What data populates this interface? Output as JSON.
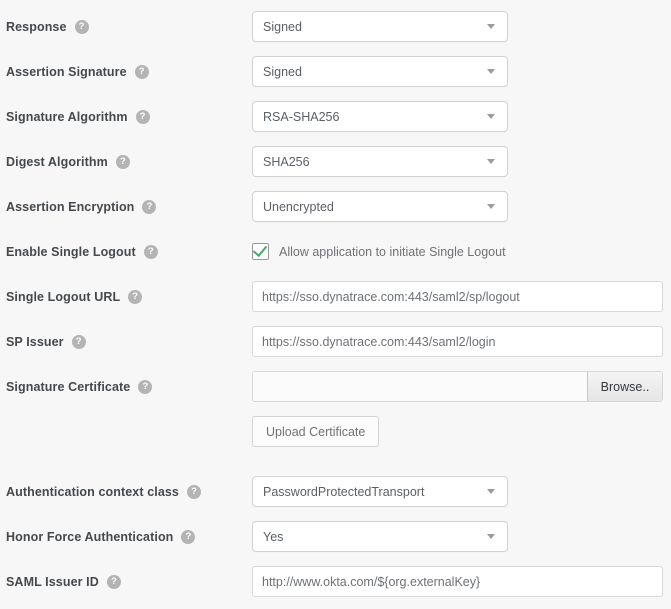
{
  "help_icon_glyph": "?",
  "colors": {
    "page_background": "#f7f7f7",
    "label_text": "#45494d",
    "value_text": "#5b6066",
    "help_bubble": "#b4b4b4",
    "checkbox_check": "#4aa96c",
    "field_border": "#d2d2d2"
  },
  "rows": [
    {
      "label": "Response",
      "type": "select",
      "value": "Signed"
    },
    {
      "label": "Assertion Signature",
      "type": "select",
      "value": "Signed"
    },
    {
      "label": "Signature Algorithm",
      "type": "select",
      "value": "RSA-SHA256"
    },
    {
      "label": "Digest Algorithm",
      "type": "select",
      "value": "SHA256"
    },
    {
      "label": "Assertion Encryption",
      "type": "select",
      "value": "Unencrypted"
    },
    {
      "label": "Enable Single Logout",
      "type": "checkbox",
      "checked": true,
      "checkbox_label": "Allow application to initiate Single Logout"
    },
    {
      "label": "Single Logout URL",
      "type": "text",
      "value": "https://sso.dynatrace.com:443/saml2/sp/logout",
      "placeholder": ""
    },
    {
      "label": "SP Issuer",
      "type": "text",
      "value": "https://sso.dynatrace.com:443/saml2/login",
      "placeholder": ""
    },
    {
      "label": "Signature Certificate",
      "type": "file",
      "value": "",
      "browse_label": "Browse..",
      "upload_label": "Upload Certificate"
    },
    {
      "label": "Authentication context class",
      "type": "select",
      "value": "PasswordProtectedTransport"
    },
    {
      "label": "Honor Force Authentication",
      "type": "select",
      "value": "Yes"
    },
    {
      "label": "SAML Issuer ID",
      "type": "text",
      "value": "http://www.okta.com/${org.externalKey}",
      "placeholder": ""
    }
  ]
}
